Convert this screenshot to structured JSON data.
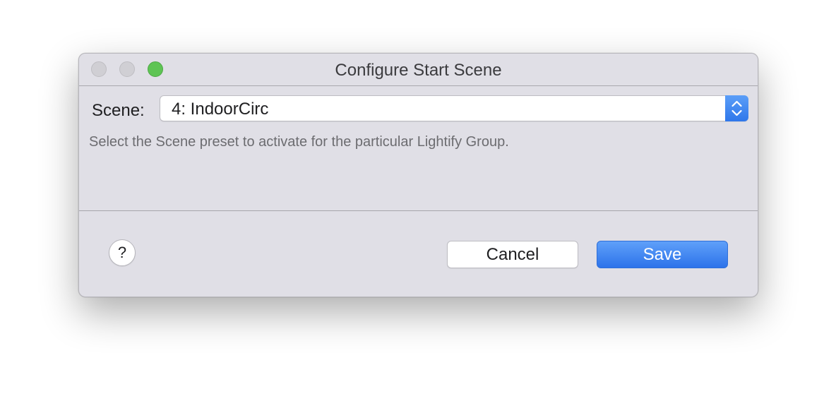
{
  "window": {
    "title": "Configure Start Scene",
    "traffic_lights": {
      "close_color": "#d0cfd4",
      "minimize_color": "#d0cfd4",
      "zoom_color": "#5ec454"
    }
  },
  "form": {
    "scene_label": "Scene:",
    "scene_value": "4: IndoorCirc",
    "description": "Select the Scene preset to activate for the particular Lightify Group."
  },
  "footer": {
    "help_label": "?",
    "cancel_label": "Cancel",
    "save_label": "Save"
  },
  "colors": {
    "accent": "#2f77ea",
    "window_bg": "#e0dfe6"
  },
  "icons": {
    "stepper": "chevron-up-down-icon"
  }
}
